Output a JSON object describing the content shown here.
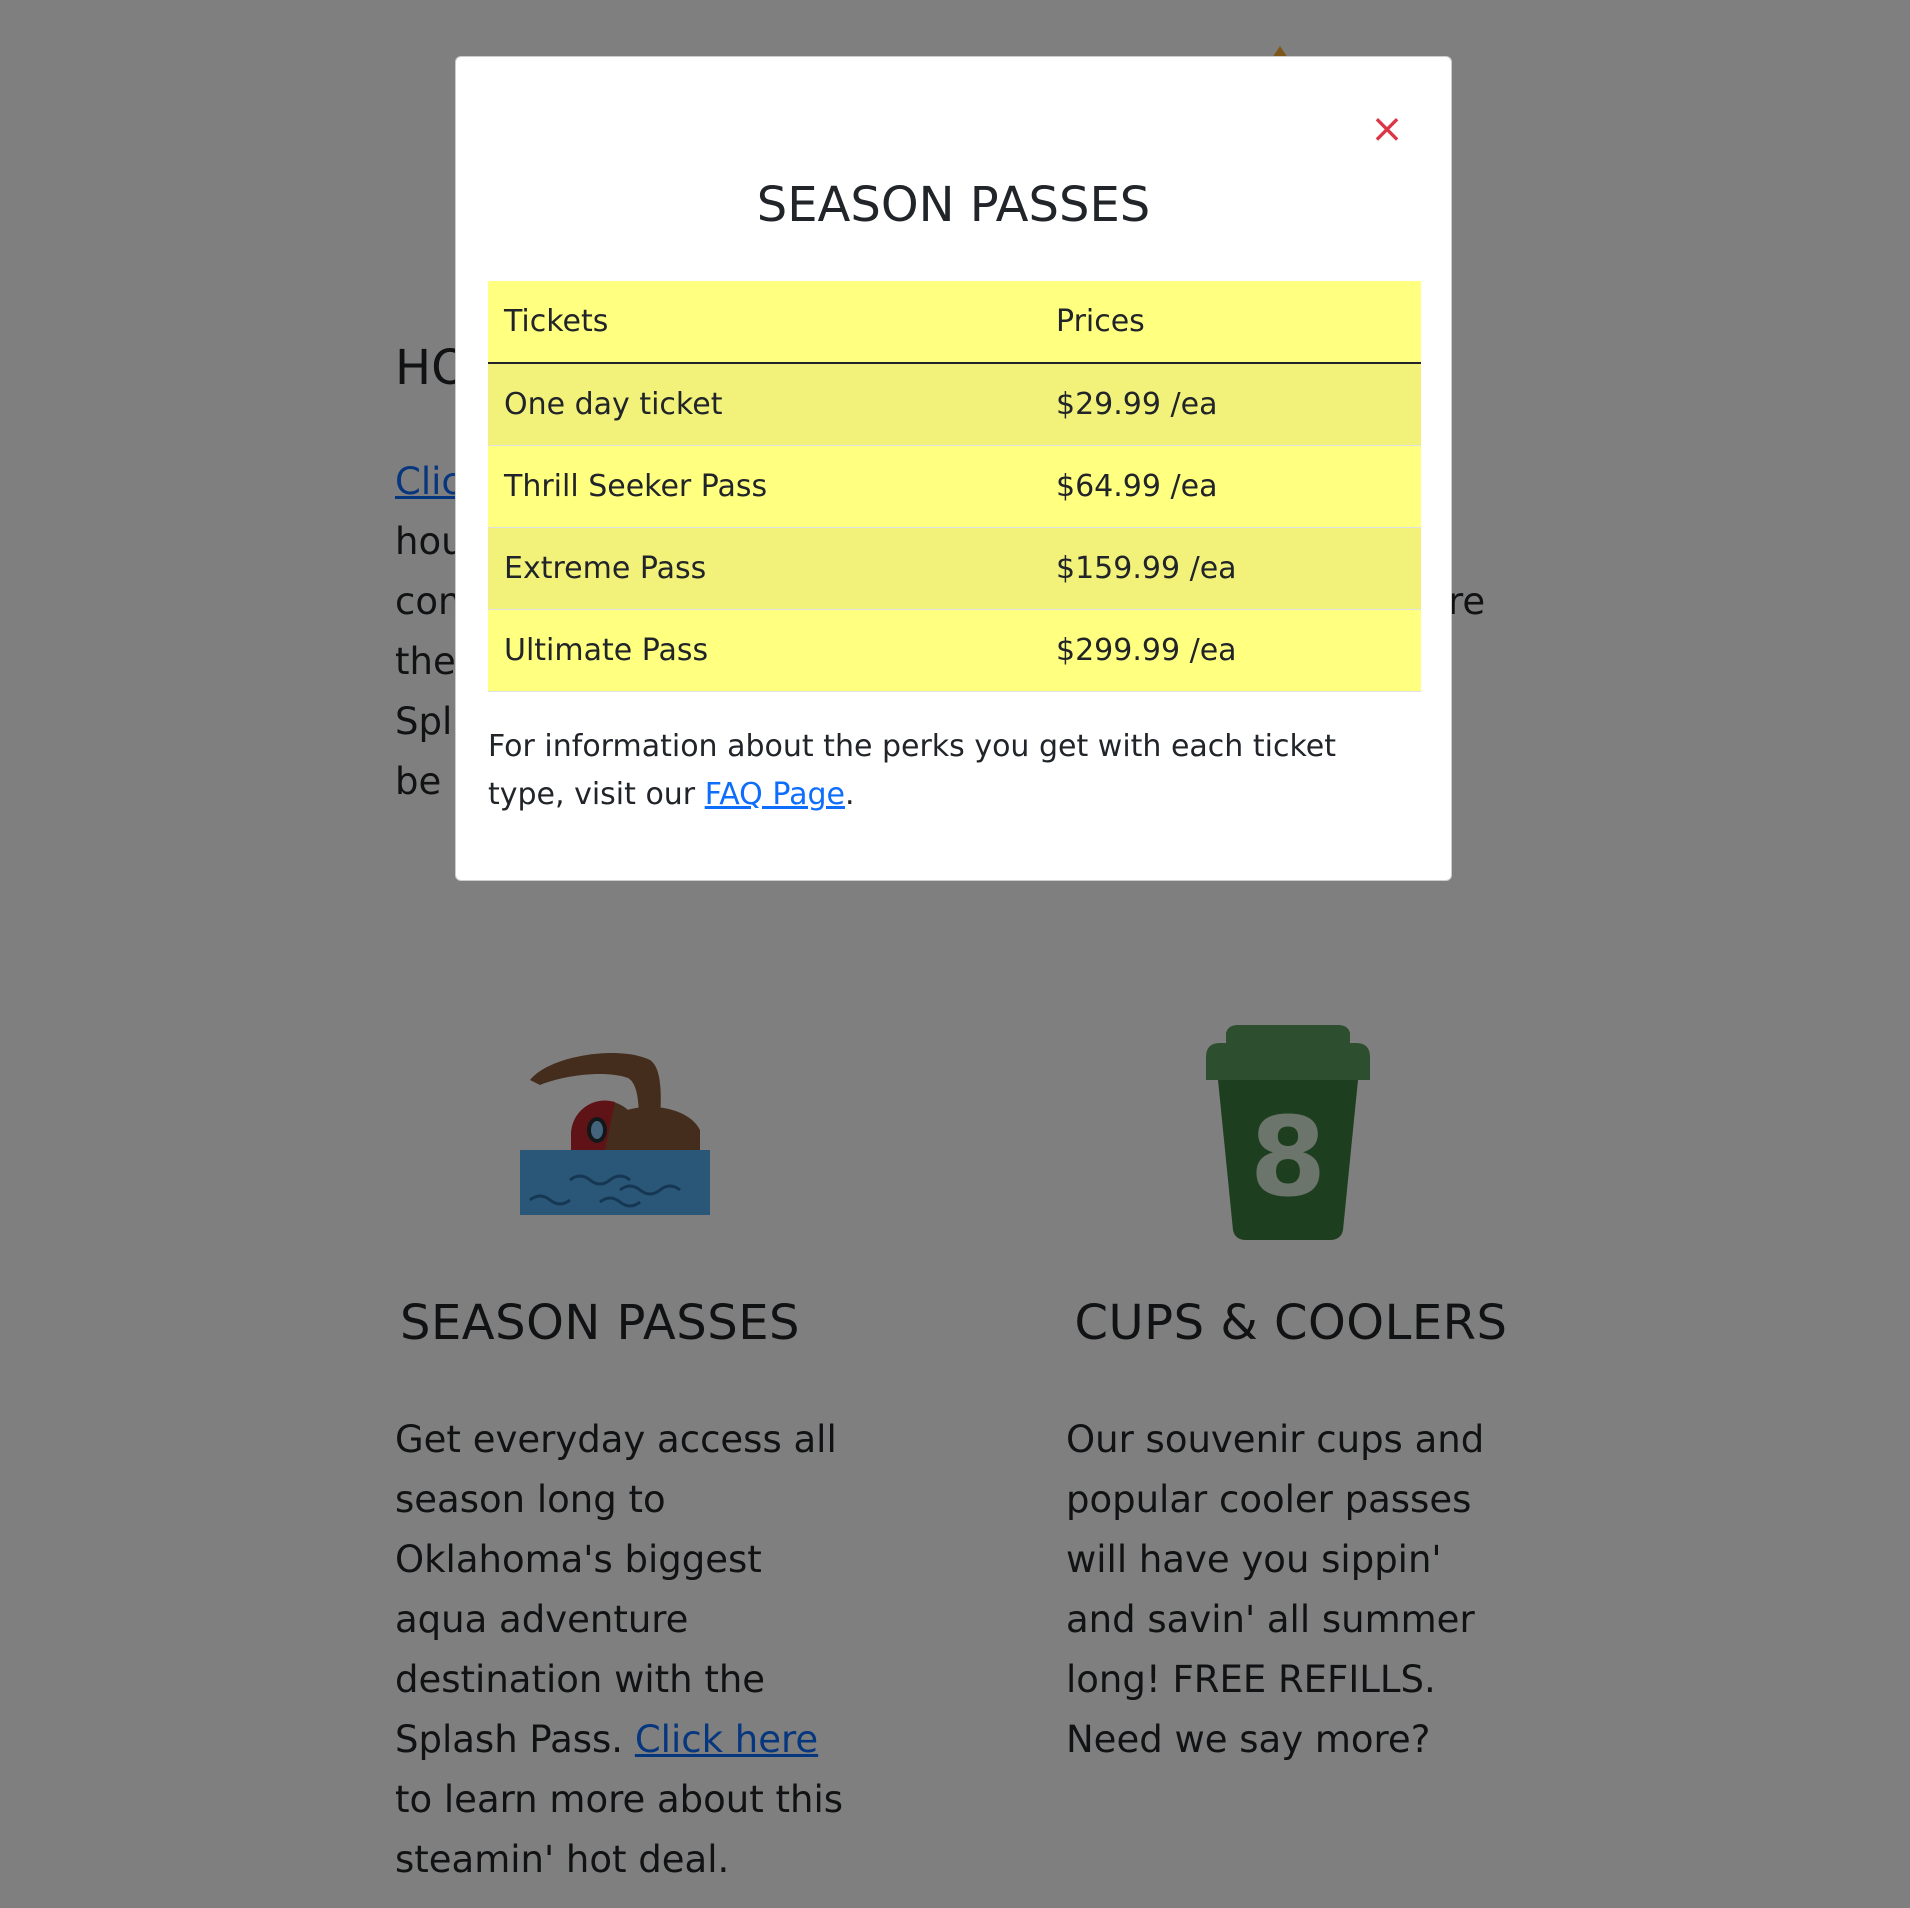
{
  "background": {
    "hours": {
      "heading": "HO",
      "link_text": "Clic",
      "lines": [
        "hou",
        "con",
        "the",
        "Spl",
        "be a"
      ],
      "peek_right": "re"
    },
    "season_passes": {
      "icon": "swimmer-icon",
      "title": "SEASON PASSES",
      "text_before_link": "Get everyday access all season long to Oklahoma's biggest aqua adventure destination with the Splash Pass. ",
      "link_text": "Click here",
      "text_after_link": " to learn more about this steamin' hot deal."
    },
    "cups_coolers": {
      "icon": "cup-8-icon",
      "icon_number": "8",
      "title": "CUPS & COOLERS",
      "text": "Our souvenir cups and popular cooler passes will have you sippin' and savin' all summer long! FREE REFILLS. Need we say more?"
    }
  },
  "modal": {
    "close_label": "×",
    "title": "SEASON PASSES",
    "table": {
      "headers": [
        "Tickets",
        "Prices"
      ],
      "rows": [
        {
          "ticket": "One day ticket",
          "price": "$29.99 /ea"
        },
        {
          "ticket": "Thrill Seeker Pass",
          "price": "$64.99 /ea"
        },
        {
          "ticket": "Extreme Pass",
          "price": "$159.99 /ea"
        },
        {
          "ticket": "Ultimate Pass",
          "price": "$299.99 /ea"
        }
      ]
    },
    "info_text": "For information about the perks you get with each ticket type, visit our ",
    "info_link": "FAQ Page",
    "info_end": "."
  },
  "colors": {
    "backdrop": "#808080",
    "table_header_bg": "#ffff80",
    "table_stripe_bg": "#f2f27a",
    "close_icon": "#dc3545",
    "link": "#0d6efd",
    "cup_green": "#3b7d3e"
  }
}
